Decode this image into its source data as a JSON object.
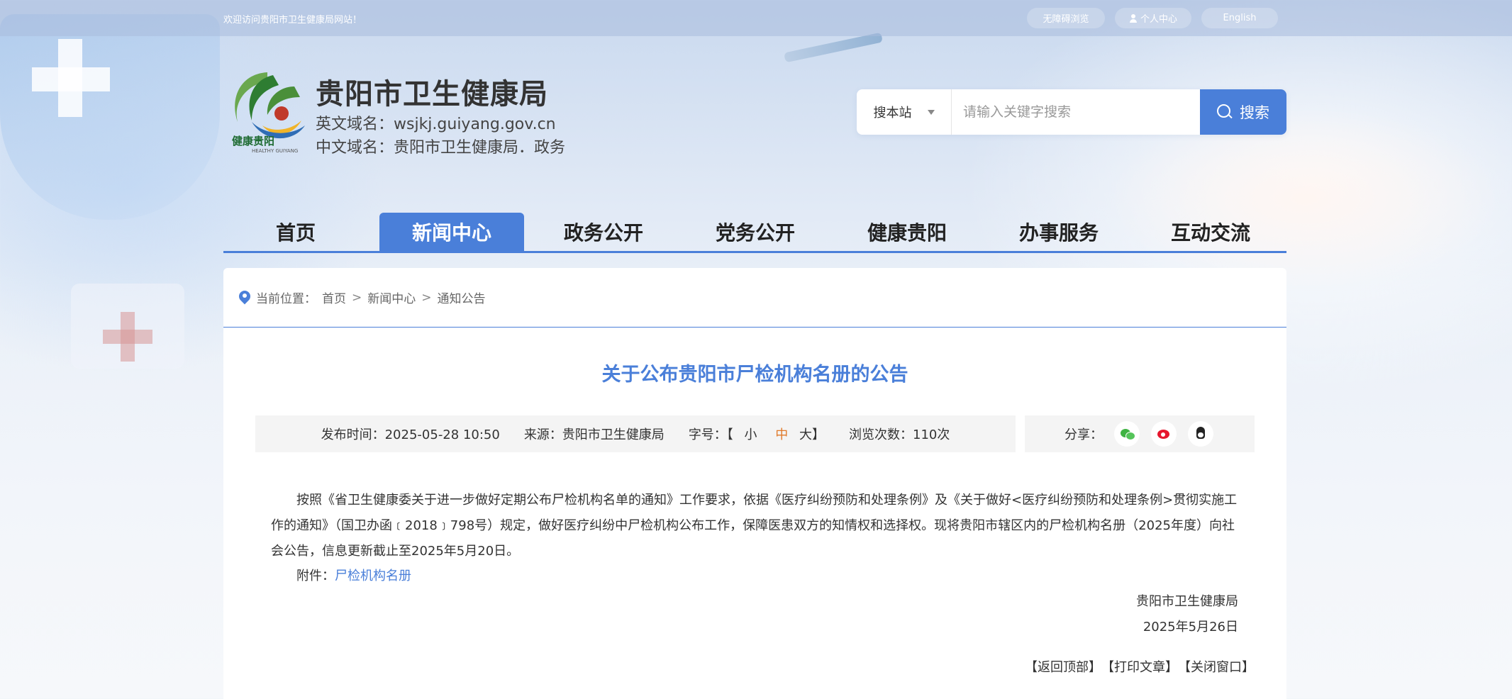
{
  "topbar": {
    "welcome": "欢迎访问贵阳市卫生健康局网站！",
    "accessible_label": "无障碍浏览",
    "personal_label": "个人中心",
    "english_label": "English"
  },
  "header": {
    "title": "贵阳市卫生健康局",
    "en_domain": "英文域名：wsjkj.guiyang.gov.cn",
    "cn_domain": "中文域名：贵阳市卫生健康局．政务",
    "logo_text": "健康贵阳",
    "logo_sub": "HEALTHY GUIYANG"
  },
  "search": {
    "scope": "搜本站",
    "placeholder": "请输入关键字搜索",
    "button_label": "搜索"
  },
  "nav": {
    "items": [
      {
        "label": "首页"
      },
      {
        "label": "新闻中心"
      },
      {
        "label": "政务公开"
      },
      {
        "label": "党务公开"
      },
      {
        "label": "健康贵阳"
      },
      {
        "label": "办事服务"
      },
      {
        "label": "互动交流"
      }
    ],
    "active_index": 1
  },
  "breadcrumb": {
    "prefix": "当前位置：",
    "items": [
      "首页",
      "新闻中心",
      "通知公告"
    ],
    "separator": ">"
  },
  "article": {
    "title": "关于公布贵阳市尸检机构名册的公告",
    "publish_time": "发布时间：2025-05-28 10:50",
    "source": "来源：贵阳市卫生健康局",
    "font_size_label": "字号：【",
    "font_small": "小",
    "font_medium": "中",
    "font_large": "大】",
    "views": "浏览次数：110次",
    "share_label": "分享：",
    "body": "按照《省卫生健康委关于进一步做好定期公布尸检机构名单的通知》工作要求，依据《医疗纠纷预防和处理条例》及《关于做好<医疗纠纷预防和处理条例>贯彻实施工作的通知》（国卫办函﹝2018﹞798号）规定，做好医疗纠纷中尸检机构公布工作，保障医患双方的知情权和选择权。现将贵阳市辖区内的尸检机构名册（2025年度）向社会公告，信息更新截止至2025年5月20日。",
    "attachment_label": "附件：",
    "attachment_link": "尸检机构名册",
    "signature_org": "贵阳市卫生健康局",
    "signature_date": "2025年5月26日",
    "back_top": "【返回顶部】",
    "print": "【打印文章】",
    "close": "【关闭窗口】"
  },
  "colors": {
    "accent": "#4a7fd9",
    "font_mid": "#e07a2b"
  }
}
